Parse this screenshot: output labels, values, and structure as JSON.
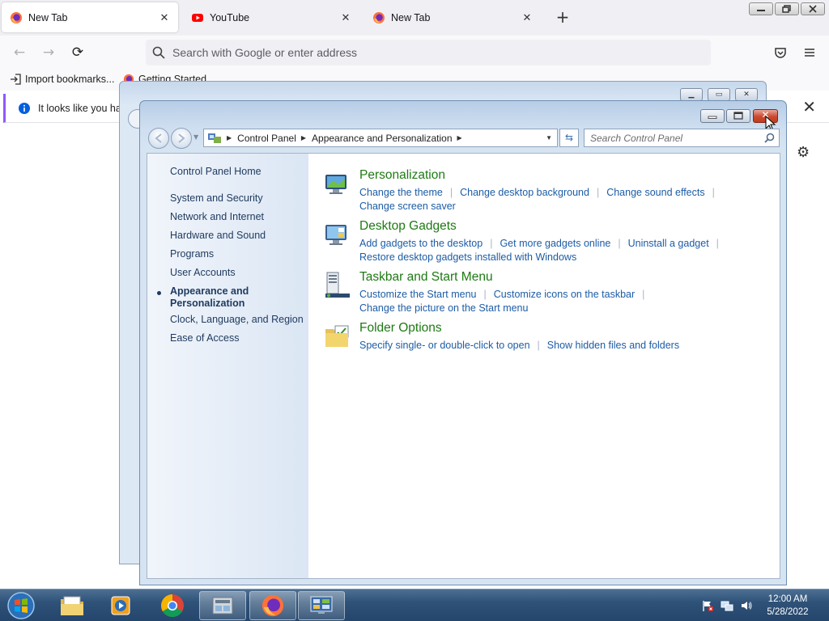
{
  "browser": {
    "tabs": [
      {
        "label": "New Tab",
        "icon": "firefox-icon",
        "active": true
      },
      {
        "label": "YouTube",
        "icon": "youtube-icon",
        "active": false
      },
      {
        "label": "New Tab",
        "icon": "firefox-icon",
        "active": false
      }
    ],
    "new_tab_symbol": "+",
    "url_placeholder": "Search with Google or enter address",
    "bookmarks": [
      {
        "label": "Import bookmarks...",
        "icon": "import-icon"
      },
      {
        "label": "Getting Started",
        "icon": "firefox-icon"
      }
    ],
    "notice_text": "It looks like you hav"
  },
  "control_panel": {
    "breadcrumb": [
      "Control Panel",
      "Appearance and Personalization"
    ],
    "search_placeholder": "Search Control Panel",
    "sidebar": {
      "home": "Control Panel Home",
      "items": [
        "System and Security",
        "Network and Internet",
        "Hardware and Sound",
        "Programs",
        "User Accounts",
        "Appearance and",
        "Personalization",
        "Clock, Language, and Region",
        "Ease of Access"
      ],
      "current": "Appearance and Personalization"
    },
    "categories": [
      {
        "title": "Personalization",
        "icon": "personalization-icon",
        "links": [
          "Change the theme",
          "Change desktop background",
          "Change sound effects",
          "Change screen saver"
        ]
      },
      {
        "title": "Desktop Gadgets",
        "icon": "desktop-gadgets-icon",
        "links": [
          "Add gadgets to the desktop",
          "Get more gadgets online",
          "Uninstall a gadget",
          "Restore desktop gadgets installed with Windows"
        ]
      },
      {
        "title": "Taskbar and Start Menu",
        "icon": "taskbar-icon",
        "links": [
          "Customize the Start menu",
          "Customize icons on the taskbar",
          "Change the picture on the Start menu"
        ]
      },
      {
        "title": "Folder Options",
        "icon": "folder-options-icon",
        "links": [
          "Specify single- or double-click to open",
          "Show hidden files and folders"
        ]
      }
    ]
  },
  "taskbar": {
    "time": "12:00 AM",
    "date": "5/28/2022",
    "apps": [
      "file-explorer-icon",
      "media-player-icon",
      "chrome-icon",
      "documents-icon",
      "firefox-icon",
      "control-panel-icon"
    ]
  },
  "colors": {
    "category_title": "#1e7a14",
    "link": "#1c5ca6",
    "sidebar_text": "#1e3a5f",
    "close_button": "#c94a30"
  }
}
